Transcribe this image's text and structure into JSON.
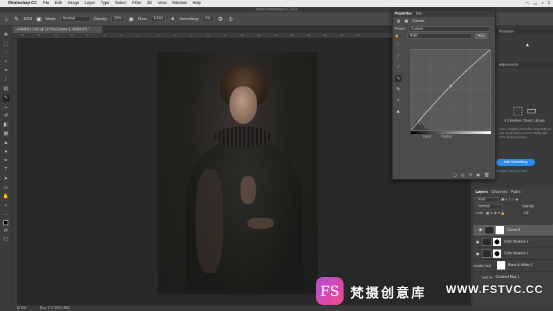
{
  "menubar": {
    "app": "Photoshop CC",
    "items": [
      "File",
      "Edit",
      "Image",
      "Layer",
      "Type",
      "Select",
      "Filter",
      "3D",
      "View",
      "Window",
      "Help"
    ]
  },
  "window": {
    "title": "Adobe Photoshop CC 2019"
  },
  "options": {
    "brush_size": "1978",
    "mode_label": "Mode:",
    "mode_value": "Normal",
    "opacity_label": "Opacity:",
    "opacity_value": "25%",
    "flow_label": "Flow:",
    "flow_value": "100%",
    "smoothing_label": "Smoothing:",
    "smoothing_value": "0%"
  },
  "document": {
    "tab_label": "_V6A4022.CR2 @ 12.5% (Curves 1, RGB/16*) *"
  },
  "ruler": {
    "ticks": [
      "16",
      "14",
      "12",
      "10",
      "8",
      "6",
      "4",
      "2",
      "0",
      "2",
      "4",
      "6",
      "8",
      "10",
      "12",
      "14",
      "16",
      "18",
      "20",
      "22",
      "24"
    ]
  },
  "status": {
    "zoom": "12.5%",
    "doc": "Doc: 172.3M/1.48G"
  },
  "properties": {
    "tabs": [
      "Properties",
      "Info"
    ],
    "header": "Curves",
    "preset_label": "Preset:",
    "preset_value": "Custom",
    "channel": "RGB",
    "auto_label": "Auto",
    "input_label": "Input:",
    "output_label": "Output:",
    "curve_points": [
      [
        0,
        0
      ],
      [
        128,
        140
      ],
      [
        255,
        255
      ]
    ]
  },
  "navigator": {
    "tab": "Navigator"
  },
  "adjustments": {
    "tab": "Adjustments"
  },
  "library": {
    "title": "s Creative Cloud Library",
    "desc": "olors, images, and other frequently ou can easily share across Adobe aps. Let's show you how.",
    "button": "Add Something",
    "link": "h Adobe Stock for free"
  },
  "layers": {
    "tabs": [
      "Layers",
      "Channels",
      "Paths"
    ],
    "filter_kind": "Kind",
    "blend": "Normal",
    "opacity_label": "Opacity:",
    "lock_label": "Lock:",
    "fill_label": "Fill:",
    "items": [
      {
        "name": "Curves 1"
      },
      {
        "name": "Color Balance 2"
      },
      {
        "name": "Color Balance 1"
      },
      {
        "name": "Black & White 1",
        "prefix": "heedlar heal"
      },
      {
        "name": "Gradient Map 1",
        "prefix": "hear he"
      }
    ]
  },
  "watermark": {
    "logo": "FS",
    "cn": "梵摄创意库",
    "url": "WWW.FSTVC.CC"
  }
}
